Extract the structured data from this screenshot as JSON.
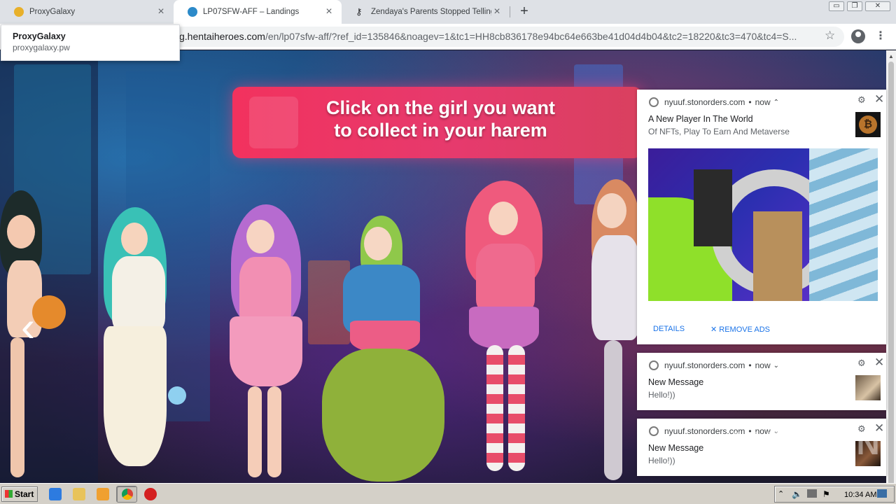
{
  "browser": {
    "tabs": [
      {
        "title": "ProxyGalaxy"
      },
      {
        "title": "LP07SFW-AFF – Landings"
      },
      {
        "title": "Zendaya's Parents Stopped Telling H"
      }
    ],
    "new_tab": "+",
    "url_prefix": "g.hentaiheroes.com",
    "url_rest": "/en/lp07sfw-aff/?ref_id=135846&noagev=1&tc1=HH8cb836178e94bc64e663be41d04d4b04&tc2=18220&tc3=470&tc4=S...",
    "window_controls": [
      "▭",
      "❐",
      "✕"
    ]
  },
  "popup": {
    "title": "ProxyGalaxy",
    "domain": "proxygalaxy.pw"
  },
  "page": {
    "banner_line1": "Click on the girl you want",
    "banner_line2": "to collect in your harem",
    "arrow": "‹"
  },
  "notifications": [
    {
      "source": "nyuuf.stonorders.com",
      "time": "now",
      "title": "A New Player In The World",
      "text": "Of NFTs, Play To Earn And Metaverse",
      "details": "DETAILS",
      "remove": "✕ REMOVE ADS"
    },
    {
      "source": "nyuuf.stonorders.com",
      "time": "now",
      "title": "New Message",
      "text": "Hello!))"
    },
    {
      "source": "nyuuf.stonorders.com",
      "time": "now",
      "title": "New Message",
      "text": "Hello!))"
    }
  ],
  "taskbar": {
    "start": "Start",
    "clock": "10:34 AM"
  },
  "watermark": "ANY RUN"
}
